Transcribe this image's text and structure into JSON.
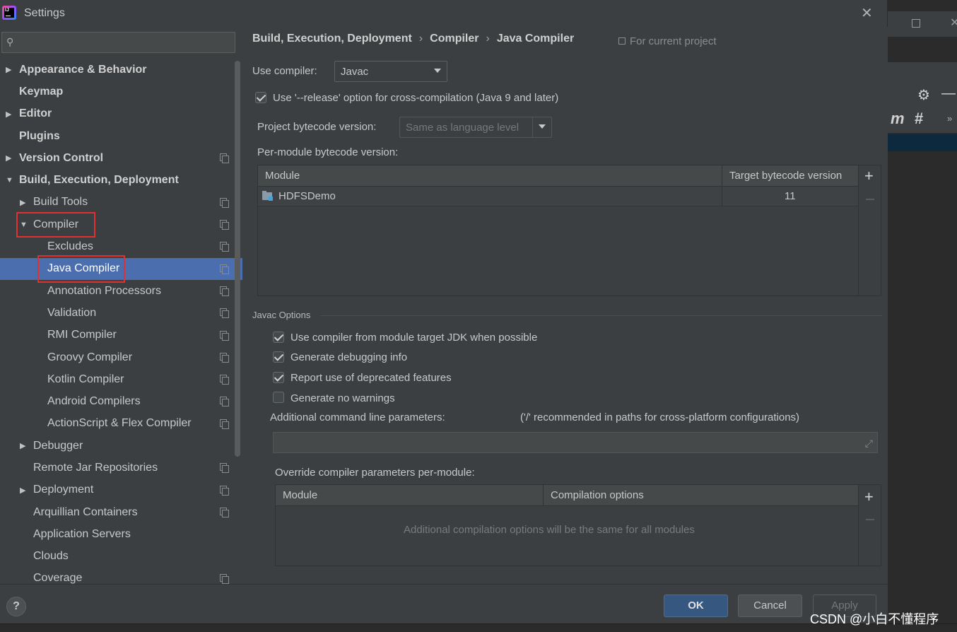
{
  "window": {
    "title": "Settings"
  },
  "search": {
    "placeholder": "",
    "value": ""
  },
  "sidebar": {
    "items": [
      {
        "label": "Appearance & Behavior",
        "arrow": "▶",
        "indent": 0,
        "bold": true
      },
      {
        "label": "Keymap",
        "arrow": "",
        "indent": 0,
        "bold": true
      },
      {
        "label": "Editor",
        "arrow": "▶",
        "indent": 0,
        "bold": true
      },
      {
        "label": "Plugins",
        "arrow": "",
        "indent": 0,
        "bold": true
      },
      {
        "label": "Version Control",
        "arrow": "▶",
        "indent": 0,
        "bold": true,
        "copy": true
      },
      {
        "label": "Build, Execution, Deployment",
        "arrow": "▼",
        "indent": 0,
        "bold": true
      },
      {
        "label": "Build Tools",
        "arrow": "▶",
        "indent": 1,
        "copy": true
      },
      {
        "label": "Compiler",
        "arrow": "▼",
        "indent": 1,
        "copy": true
      },
      {
        "label": "Excludes",
        "arrow": "",
        "indent": 2,
        "copy": true
      },
      {
        "label": "Java Compiler",
        "arrow": "",
        "indent": 2,
        "copy": true,
        "selected": true
      },
      {
        "label": "Annotation Processors",
        "arrow": "",
        "indent": 2,
        "copy": true
      },
      {
        "label": "Validation",
        "arrow": "",
        "indent": 2,
        "copy": true
      },
      {
        "label": "RMI Compiler",
        "arrow": "",
        "indent": 2,
        "copy": true
      },
      {
        "label": "Groovy Compiler",
        "arrow": "",
        "indent": 2,
        "copy": true
      },
      {
        "label": "Kotlin Compiler",
        "arrow": "",
        "indent": 2,
        "copy": true
      },
      {
        "label": "Android Compilers",
        "arrow": "",
        "indent": 2,
        "copy": true
      },
      {
        "label": "ActionScript & Flex Compiler",
        "arrow": "",
        "indent": 2,
        "copy": true
      },
      {
        "label": "Debugger",
        "arrow": "▶",
        "indent": 1
      },
      {
        "label": "Remote Jar Repositories",
        "arrow": "",
        "indent": 1,
        "copy": true
      },
      {
        "label": "Deployment",
        "arrow": "▶",
        "indent": 1,
        "copy": true
      },
      {
        "label": "Arquillian Containers",
        "arrow": "",
        "indent": 1,
        "copy": true
      },
      {
        "label": "Application Servers",
        "arrow": "",
        "indent": 1
      },
      {
        "label": "Clouds",
        "arrow": "",
        "indent": 1
      },
      {
        "label": "Coverage",
        "arrow": "",
        "indent": 1,
        "copy": true
      }
    ]
  },
  "breadcrumb": {
    "parts": [
      "Build, Execution, Deployment",
      "Compiler",
      "Java Compiler"
    ],
    "separator": "›"
  },
  "scope_label": "For current project",
  "use_compiler": {
    "label": "Use compiler:",
    "value": "Javac"
  },
  "release_option": {
    "label": "Use '--release' option for cross-compilation (Java 9 and later)",
    "checked": true
  },
  "project_bytecode": {
    "label": "Project bytecode version:",
    "value": "Same as language level"
  },
  "per_module": {
    "label": "Per-module bytecode version:",
    "columns": [
      "Module",
      "Target bytecode version"
    ],
    "rows": [
      {
        "module": "HDFSDemo",
        "version": "11"
      }
    ]
  },
  "javac_options": {
    "title": "Javac Options",
    "checkboxes": [
      {
        "label": "Use compiler from module target JDK when possible",
        "checked": true
      },
      {
        "label": "Generate debugging info",
        "checked": true
      },
      {
        "label": "Report use of deprecated features",
        "checked": true
      },
      {
        "label": "Generate no warnings",
        "checked": false
      }
    ],
    "additional_label": "Additional command line parameters:",
    "additional_hint": "('/' recommended in paths for cross-platform configurations)",
    "additional_value": ""
  },
  "override": {
    "label": "Override compiler parameters per-module:",
    "columns": [
      "Module",
      "Compilation options"
    ],
    "empty_text": "Additional compilation options will be the same for all modules"
  },
  "buttons": {
    "help": "?",
    "ok": "OK",
    "cancel": "Cancel",
    "apply": "Apply"
  },
  "watermark": "CSDN @小白不懂程序",
  "colors": {
    "selection": "#4b6eaf",
    "highlight_box": "#e03030",
    "ok_button": "#365880"
  }
}
